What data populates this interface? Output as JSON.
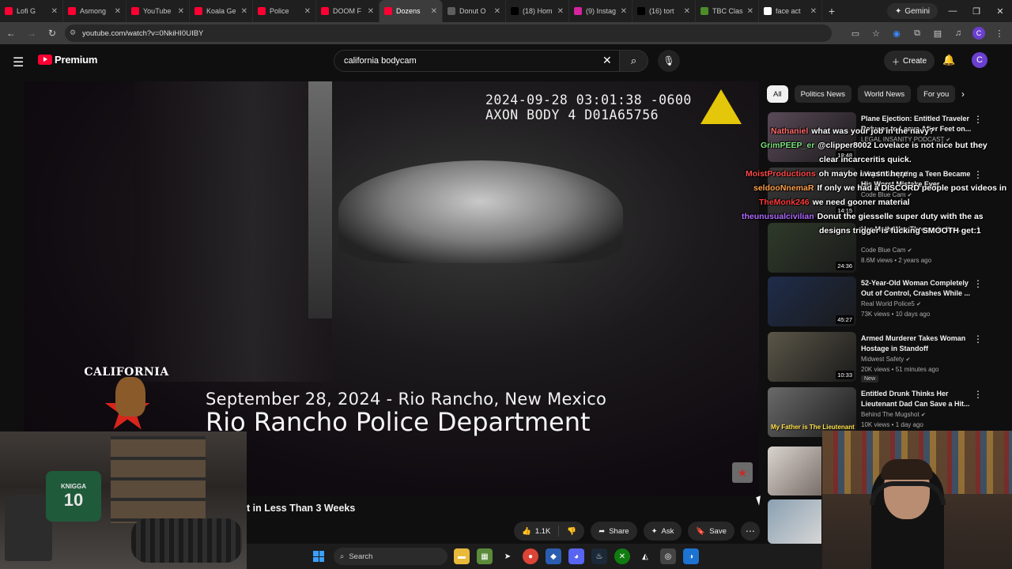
{
  "browser": {
    "tabs": [
      {
        "label": "Lofi G",
        "color": "#ff0033",
        "active": false
      },
      {
        "label": "Asmong",
        "color": "#ff0033",
        "active": false
      },
      {
        "label": "YouTube",
        "color": "#ff0033",
        "active": false
      },
      {
        "label": "Koala Ge",
        "color": "#ff0033",
        "active": false
      },
      {
        "label": "Police",
        "color": "#ff0033",
        "active": false
      },
      {
        "label": "DOOM F",
        "color": "#ff0033",
        "active": false
      },
      {
        "label": "Dozens",
        "color": "#ff0033",
        "active": true
      },
      {
        "label": "Donut O",
        "color": "#5e5e5e",
        "active": false
      },
      {
        "label": "(18) Hom",
        "color": "#000000",
        "active": false
      },
      {
        "label": "(9) Instag",
        "color": "#d6249f",
        "active": false
      },
      {
        "label": "(16) tort",
        "color": "#000000",
        "active": false
      },
      {
        "label": "TBC Clas",
        "color": "#4c8c2b",
        "active": false
      },
      {
        "label": "face act",
        "color": "#ffffff",
        "active": false
      }
    ],
    "new_tab": "+",
    "gemini_label": "Gemini",
    "url": "youtube.com/watch?v=0NkiHI0UIBY"
  },
  "youtube": {
    "logo_text": "Premium",
    "search_value": "california bodycam",
    "create_label": "Create",
    "avatar_letter": "C",
    "chips": [
      "All",
      "Politics News",
      "World News",
      "For you"
    ]
  },
  "player": {
    "timestamp_line1": "2024-09-28 03:01:38 -0600",
    "timestamp_line2": "AXON BODY 4 D01A65756",
    "badge_text": "CALIFORNIA",
    "overlay_date": "September 28, 2024 - Rio Rancho, New Mexico",
    "overlay_dept": "Rio Rancho Police Department"
  },
  "video": {
    "title_fragment": "t in Less Than 3 Weeks",
    "like_count": "1.1K",
    "share_label": "Share",
    "ask_label": "Ask",
    "save_label": "Save"
  },
  "related": [
    {
      "title": "Plane Ejection: Entitled Traveler Refuses to Leave After Feet on...",
      "channel": "LEGAL INSANITY PODCAST",
      "meta": "",
      "duration": "18:48",
      "badge": "",
      "thumb_color": "#5a4a58"
    },
    {
      "title": "Why Kidnapping a Teen Became His Worst Mistake Ever",
      "channel": "Code Blue Cam",
      "meta": "",
      "duration": "14:15",
      "badge": "",
      "thumb_color": "#3a3a3a"
    },
    {
      "title": "Her Meth Was Thrown in the ...",
      "channel": "Code Blue Cam",
      "meta": "8.6M views • 2 years ago",
      "duration": "24:36",
      "badge": "",
      "thumb_color": "#2f3a2a"
    },
    {
      "title": "52-Year-Old Woman Completely Out of Control, Crashes While ...",
      "channel": "Real World Police5",
      "meta": "73K views • 10 days ago",
      "duration": "45:27",
      "badge": "",
      "thumb_color": "#1e2c4a"
    },
    {
      "title": "Armed Murderer Takes Woman Hostage in Standoff",
      "channel": "Midwest Safety",
      "meta": "20K views • 51 minutes ago",
      "duration": "10:33",
      "badge": "New",
      "thumb_color": "#5b5648"
    },
    {
      "title": "Entitled Drunk Thinks Her Lieutenant Dad Can Save a Hit...",
      "channel": "Behind The Mugshot",
      "meta": "10K views • 1 day ago",
      "duration": "",
      "badge": "",
      "thumb_color": "#6a6a6a",
      "thumb_caption": "My Father is The Lieutenant"
    }
  ],
  "chat": [
    {
      "user": "Nathaniel",
      "user_color": "#ff6b6b",
      "text": "what was your job in the navy?"
    },
    {
      "user": "GrimPEEP_er",
      "user_color": "#7ee37e",
      "text": "@clipper8002 Lovelace is not nice but they"
    },
    {
      "user": "",
      "user_color": "#ffffff",
      "text": "clear incarceritis quick."
    },
    {
      "user": "MoistProductions",
      "user_color": "#ff4a4a",
      "text": "oh maybe i wasnt here"
    },
    {
      "user": "seldooNnemaR",
      "user_color": "#ff9f4a",
      "text": "If only we had a DISCORD people post videos in"
    },
    {
      "user": "TheMonk246",
      "user_color": "#ff3b3b",
      "text": "we need gooner material"
    },
    {
      "user": "theunusualcivilian",
      "user_color": "#b06bff",
      "text": "Donut the giesselle super duty with the as"
    },
    {
      "user": "",
      "user_color": "#ffffff",
      "text": "designs trigger is fucking SMOOTH get:1"
    }
  ],
  "webcam_left": {
    "jersey_text": "KNIGGA",
    "jersey_number": "10"
  },
  "taskbar": {
    "search_label": "Search"
  }
}
